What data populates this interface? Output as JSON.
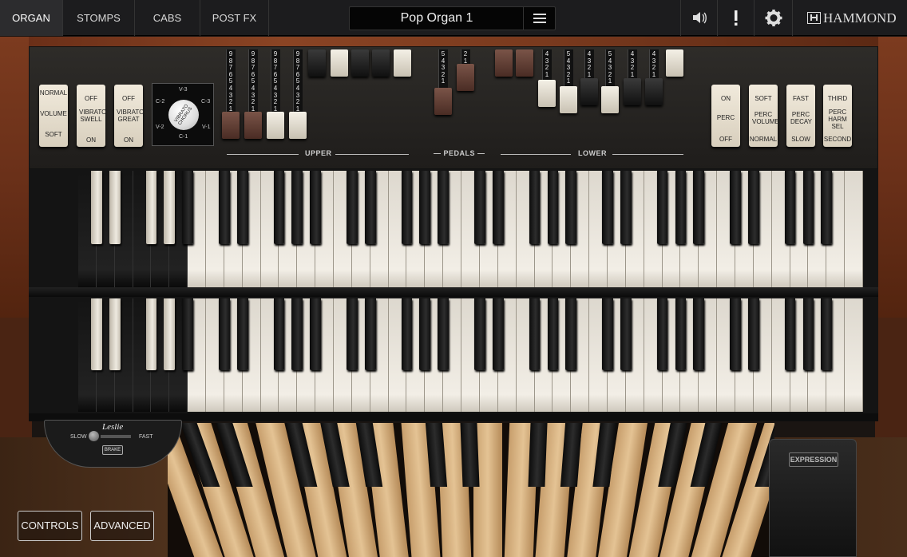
{
  "tabs": [
    "ORGAN",
    "STOMPS",
    "CABS",
    "POST FX"
  ],
  "active_tab": "ORGAN",
  "preset": {
    "name": "Pop Organ 1"
  },
  "brand": "HAMMOND",
  "switches_left": [
    {
      "top": "NORMAL",
      "mid": "VOLUME",
      "bottom": "SOFT"
    },
    {
      "top": "OFF",
      "mid": "VIBRATO SWELL",
      "bottom": "ON"
    },
    {
      "top": "OFF",
      "mid": "VIBRATO GREAT",
      "bottom": "ON"
    }
  ],
  "vibrato_knob": {
    "labels": [
      "V-3",
      "C-3",
      "V-1",
      "C-1",
      "V-2",
      "C-2"
    ],
    "center": "VIBRATO CHORUS"
  },
  "switches_right": [
    {
      "top": "ON",
      "mid": "PERC",
      "bottom": "OFF"
    },
    {
      "top": "SOFT",
      "mid": "PERC VOLUME",
      "bottom": "NORMAL"
    },
    {
      "top": "FAST",
      "mid": "PERC DECAY",
      "bottom": "SLOW"
    },
    {
      "top": "THIRD",
      "mid": "PERC HARM SEL",
      "bottom": "SECOND"
    }
  ],
  "sections": {
    "upper": "UPPER",
    "pedals": "— PEDALS —",
    "lower": "LOWER"
  },
  "leslie": {
    "logo": "Leslie",
    "slow": "SLOW",
    "fast": "FAST",
    "brake": "BRAKE"
  },
  "expression": "EXPRESSION",
  "buttons": {
    "controls": "CONTROLS",
    "advanced": "ADVANCED"
  },
  "colors": {
    "accent": "#ffffff",
    "wood": "#7a3a1e",
    "panel": "#262422"
  }
}
